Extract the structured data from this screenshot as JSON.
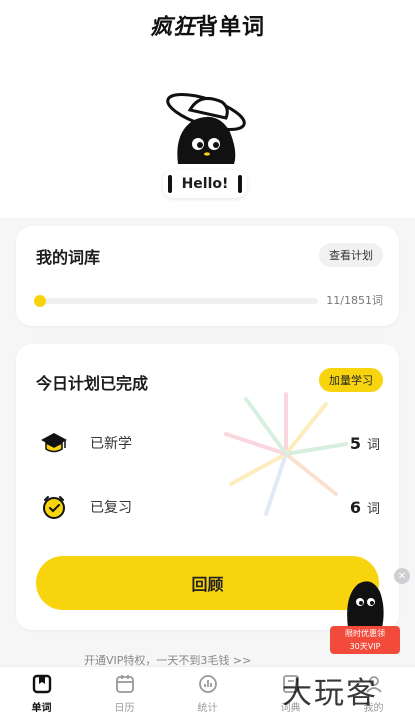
{
  "header": {
    "title_accent": "疯狂",
    "title_main": "背单词"
  },
  "hero": {
    "greeting": "Hello!"
  },
  "wordbank": {
    "title": "我的词库",
    "view_plan_label": "查看计划",
    "progress_text": "11/1851词",
    "progress_fraction": 0.006
  },
  "plan": {
    "title": "今日计划已完成",
    "extra_study_label": "加量学习",
    "learned_label": "已新学",
    "learned_value": "5",
    "learned_unit": "词",
    "reviewed_label": "已复习",
    "reviewed_value": "6",
    "reviewed_unit": "词",
    "review_button_label": "回顾"
  },
  "promo": {
    "text": "开通VIP特权，一天不到3毛钱 >>"
  },
  "floating_ad": {
    "line1": "限时优惠领",
    "line2": "30天VIP"
  },
  "tabs": [
    {
      "label": "单词",
      "icon": "book-icon",
      "active": true
    },
    {
      "label": "日历",
      "icon": "calendar-icon",
      "active": false
    },
    {
      "label": "统计",
      "icon": "chart-icon",
      "active": false
    },
    {
      "label": "词典",
      "icon": "dictionary-icon",
      "active": false
    },
    {
      "label": "我的",
      "icon": "profile-icon",
      "active": false
    }
  ],
  "watermark": "大玩客",
  "colors": {
    "accent": "#f8d40f",
    "background": "#f6f6f7",
    "ad_red": "#f24b3c"
  }
}
